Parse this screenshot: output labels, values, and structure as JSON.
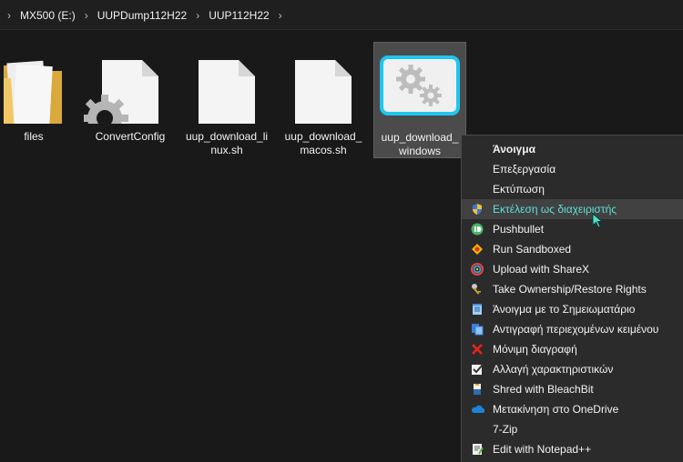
{
  "breadcrumb": [
    "MX500 (E:)",
    "UUPDump112H22",
    "UUP112H22"
  ],
  "files": [
    {
      "label": "files",
      "icon": "folder-icon"
    },
    {
      "label": "ConvertConfig",
      "icon": "settings-file-icon"
    },
    {
      "label": "uup_download_linux.sh",
      "icon": "document-icon"
    },
    {
      "label": "uup_download_macos.sh",
      "icon": "document-icon"
    },
    {
      "label": "uup_download_windows",
      "icon": "batch-file-icon",
      "selected": true
    }
  ],
  "context_menu": {
    "items": [
      {
        "label": "Άνοιγμα",
        "icon": "",
        "bold": true
      },
      {
        "label": "Επεξεργασία",
        "icon": ""
      },
      {
        "label": "Εκτύπωση",
        "icon": ""
      },
      {
        "label": "Εκτέλεση ως διαχειριστής",
        "icon": "uac-shield-icon",
        "highlighted": true
      },
      {
        "label": "Pushbullet",
        "icon": "pushbullet-icon"
      },
      {
        "label": "Run Sandboxed",
        "icon": "sandboxie-icon"
      },
      {
        "label": "Upload with ShareX",
        "icon": "sharex-icon"
      },
      {
        "label": "Take Ownership/Restore Rights",
        "icon": "key-icon"
      },
      {
        "label": "Άνοιγμα με το Σημειωματάριο",
        "icon": "notepad-icon"
      },
      {
        "label": "Αντιγραφή περιεχομένων κειμένου",
        "icon": "copy-text-icon"
      },
      {
        "label": "Μόνιμη διαγραφή",
        "icon": "delete-x-icon"
      },
      {
        "label": "Αλλαγή χαρακτηριστικών",
        "icon": "attributes-icon"
      },
      {
        "label": "Shred with BleachBit",
        "icon": "bleachbit-icon"
      },
      {
        "label": "Μετακίνηση στο OneDrive",
        "icon": "onedrive-icon"
      },
      {
        "label": "7-Zip",
        "icon": ""
      },
      {
        "label": "Edit with Notepad++",
        "icon": "notepadpp-icon"
      }
    ]
  },
  "colors": {
    "highlight_text": "#5ee0d6",
    "selection_bg": "#4b4b4b",
    "menu_bg": "#2b2b2b"
  }
}
